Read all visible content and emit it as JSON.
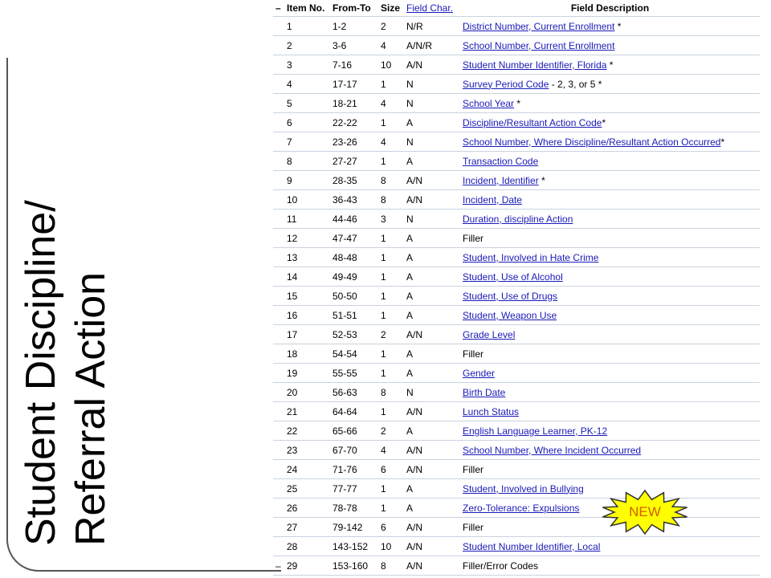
{
  "side_title": {
    "line1": "Student Discipline/",
    "line2": "Referral Action"
  },
  "header": {
    "dash": "–",
    "item_no": "Item No.",
    "from_to": "From-To",
    "size": "Size",
    "field_char": "Field Char.",
    "field_description": "Field Description"
  },
  "rows": [
    {
      "item": "1",
      "from_to": "1-2",
      "size": "2",
      "char": "N/R",
      "desc": "District Number, Current Enrollment",
      "suffix": " *",
      "link": true
    },
    {
      "item": "2",
      "from_to": "3-6",
      "size": "4",
      "char": "A/N/R",
      "desc": "School Number, Current Enrollment",
      "suffix": "",
      "link": true
    },
    {
      "item": "3",
      "from_to": "7-16",
      "size": "10",
      "char": "A/N",
      "desc": "Student Number Identifier, Florida",
      "suffix": " *",
      "link": true
    },
    {
      "item": "4",
      "from_to": "17-17",
      "size": "1",
      "char": "N",
      "desc": "Survey Period Code",
      "suffix": " - 2, 3, or 5 *",
      "link": true
    },
    {
      "item": "5",
      "from_to": "18-21",
      "size": "4",
      "char": "N",
      "desc": "School Year",
      "suffix": " *",
      "link": true
    },
    {
      "item": "6",
      "from_to": "22-22",
      "size": "1",
      "char": "A",
      "desc": "Discipline/Resultant Action Code",
      "suffix": "*",
      "link": true
    },
    {
      "item": "7",
      "from_to": "23-26",
      "size": "4",
      "char": "N",
      "desc": "School Number, Where Discipline/Resultant Action Occurred",
      "suffix": "*",
      "link": true
    },
    {
      "item": "8",
      "from_to": "27-27",
      "size": "1",
      "char": "A",
      "desc": "Transaction Code",
      "suffix": "",
      "link": true
    },
    {
      "item": "9",
      "from_to": "28-35",
      "size": "8",
      "char": "A/N",
      "desc": "Incident, Identifier",
      "suffix": " *",
      "link": true
    },
    {
      "item": "10",
      "from_to": "36-43",
      "size": "8",
      "char": "A/N",
      "desc": "Incident, Date",
      "suffix": "",
      "link": true
    },
    {
      "item": "11",
      "from_to": "44-46",
      "size": "3",
      "char": "N",
      "desc": "Duration, discipline Action",
      "suffix": "",
      "link": true
    },
    {
      "item": "12",
      "from_to": "47-47",
      "size": "1",
      "char": "A",
      "desc": "Filler",
      "suffix": "",
      "link": false
    },
    {
      "item": "13",
      "from_to": "48-48",
      "size": "1",
      "char": "A",
      "desc": "Student, Involved in Hate Crime",
      "suffix": "",
      "link": true
    },
    {
      "item": "14",
      "from_to": "49-49",
      "size": "1",
      "char": "A",
      "desc": "Student, Use of Alcohol",
      "suffix": "",
      "link": true
    },
    {
      "item": "15",
      "from_to": "50-50",
      "size": "1",
      "char": "A",
      "desc": "Student, Use of Drugs",
      "suffix": "",
      "link": true
    },
    {
      "item": "16",
      "from_to": "51-51",
      "size": "1",
      "char": "A",
      "desc": "Student, Weapon Use",
      "suffix": "",
      "link": true
    },
    {
      "item": "17",
      "from_to": "52-53",
      "size": "2",
      "char": "A/N",
      "desc": "Grade Level",
      "suffix": "",
      "link": true
    },
    {
      "item": "18",
      "from_to": "54-54",
      "size": "1",
      "char": "A",
      "desc": "Filler",
      "suffix": "",
      "link": false
    },
    {
      "item": "19",
      "from_to": "55-55",
      "size": "1",
      "char": "A",
      "desc": "Gender",
      "suffix": "",
      "link": true
    },
    {
      "item": "20",
      "from_to": "56-63",
      "size": "8",
      "char": "N",
      "desc": "Birth Date",
      "suffix": "",
      "link": true
    },
    {
      "item": "21",
      "from_to": "64-64",
      "size": "1",
      "char": "A/N",
      "desc": "Lunch Status",
      "suffix": "",
      "link": true
    },
    {
      "item": "22",
      "from_to": "65-66",
      "size": "2",
      "char": "A",
      "desc": "English Language Learner, PK-12",
      "suffix": "",
      "link": true
    },
    {
      "item": "23",
      "from_to": "67-70",
      "size": "4",
      "char": "A/N",
      "desc": "School Number, Where Incident Occurred",
      "suffix": "",
      "link": true
    },
    {
      "item": "24",
      "from_to": "71-76",
      "size": "6",
      "char": "A/N",
      "desc": "Filler",
      "suffix": "",
      "link": false
    },
    {
      "item": "25",
      "from_to": "77-77",
      "size": "1",
      "char": "A",
      "desc": "Student, Involved in Bullying",
      "suffix": "",
      "link": true
    },
    {
      "item": "26",
      "from_to": "78-78",
      "size": "1",
      "char": "A",
      "desc": "Zero-Tolerance: Expulsions",
      "suffix": "",
      "link": true
    },
    {
      "item": "27",
      "from_to": "79-142",
      "size": "6",
      "char": "A/N",
      "desc": "Filler",
      "suffix": "",
      "link": false
    },
    {
      "item": "28",
      "from_to": "143-152",
      "size": "10",
      "char": "A/N",
      "desc": "Student Number Identifier, Local",
      "suffix": "",
      "link": true
    },
    {
      "item": "29",
      "from_to": "153-160",
      "size": "8",
      "char": "A/N",
      "desc": "Filler/Error Codes",
      "suffix": "",
      "link": false
    }
  ],
  "badge": {
    "text": "NEW",
    "fill": "#ffff00",
    "stroke": "#333333"
  },
  "colors": {
    "link": "#1a1ab8",
    "row_border": "#c9d3df"
  }
}
